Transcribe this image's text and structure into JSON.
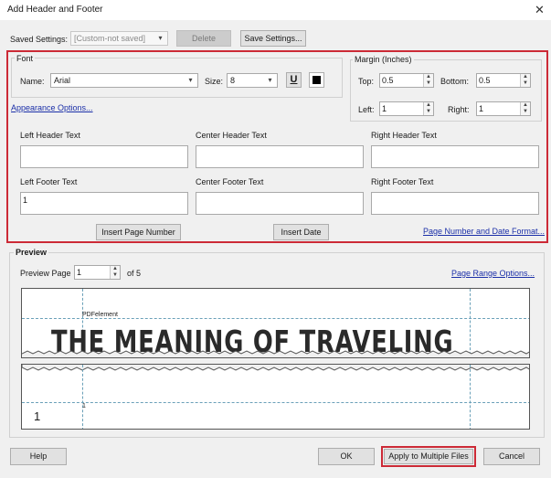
{
  "window": {
    "title": "Add Header and Footer",
    "close_glyph": "✕"
  },
  "saved_settings": {
    "label": "Saved Settings:",
    "value": "[Custom-not saved]",
    "delete_label": "Delete",
    "save_label": "Save Settings..."
  },
  "font": {
    "group_label": "Font",
    "name_label": "Name:",
    "name_value": "Arial",
    "size_label": "Size:",
    "size_value": "8",
    "underline_glyph": "U",
    "appearance_link": "Appearance Options..."
  },
  "margin": {
    "group_label": "Margin (Inches)",
    "top_label": "Top:",
    "top_value": "0.5",
    "bottom_label": "Bottom:",
    "bottom_value": "0.5",
    "left_label": "Left:",
    "left_value": "1",
    "right_label": "Right:",
    "right_value": "1"
  },
  "header_text": {
    "left_label": "Left Header Text",
    "left_value": "",
    "center_label": "Center Header Text",
    "center_value": "",
    "right_label": "Right Header Text",
    "right_value": ""
  },
  "footer_text": {
    "left_label": "Left Footer Text",
    "left_value": "1",
    "center_label": "Center Footer Text",
    "center_value": "",
    "right_label": "Right Footer Text",
    "right_value": ""
  },
  "insert": {
    "page_number_label": "Insert Page Number",
    "date_label": "Insert Date",
    "format_link": "Page Number and Date Format..."
  },
  "preview": {
    "group_label": "Preview",
    "page_label": "Preview Page",
    "page_value": "1",
    "of_label": "of 5",
    "range_link": "Page Range Options...",
    "header_small": "PDFelement",
    "big_text": "THE MEANING OF TRAVELING",
    "footer_small": "1",
    "footer_big": "1"
  },
  "buttons": {
    "help": "Help",
    "ok": "OK",
    "apply_multiple": "Apply to Multiple Files",
    "cancel": "Cancel"
  },
  "colors": {
    "highlight": "#cc2a36",
    "link": "#1b2fa8",
    "guide": "#6aa0b8"
  }
}
